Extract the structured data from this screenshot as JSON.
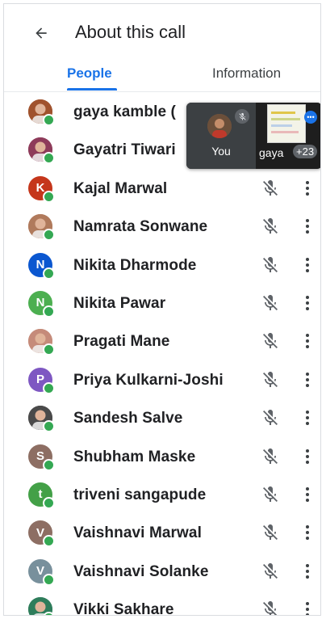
{
  "header": {
    "title": "About this call",
    "back_icon": "arrow-back-icon"
  },
  "tabs": [
    {
      "label": "People",
      "selected": true
    },
    {
      "label": "Information",
      "selected": false
    }
  ],
  "colors": {
    "accent": "#1a73e8",
    "online": "#34a853"
  },
  "participants": [
    {
      "name": "gaya kamble (",
      "avatar": "photo",
      "color": "#a0522d"
    },
    {
      "name": "Gayatri Tiwari",
      "avatar": "photo",
      "color": "#8e3b5a"
    },
    {
      "name": "Kajal Marwal",
      "avatar": "K",
      "color": "#c5361b"
    },
    {
      "name": "Namrata Sonwane",
      "avatar": "photo",
      "color": "#b07a5c"
    },
    {
      "name": "Nikita Dharmode",
      "avatar": "N",
      "color": "#0b57d0"
    },
    {
      "name": "Nikita Pawar",
      "avatar": "N",
      "color": "#4caf50"
    },
    {
      "name": "Pragati Mane",
      "avatar": "photo",
      "color": "#c58b7a"
    },
    {
      "name": "Priya Kulkarni-Joshi",
      "avatar": "P",
      "color": "#7e57c2"
    },
    {
      "name": "Sandesh Salve",
      "avatar": "photo",
      "color": "#4a4a4a"
    },
    {
      "name": "Shubham Maske",
      "avatar": "S",
      "color": "#8d6e63"
    },
    {
      "name": "triveni sangapude",
      "avatar": "t",
      "color": "#43a047"
    },
    {
      "name": "Vaishnavi Marwal",
      "avatar": "V",
      "color": "#8d6e63"
    },
    {
      "name": "Vaishnavi Solanke",
      "avatar": "V",
      "color": "#78909c"
    },
    {
      "name": "Vikki Sakhare",
      "avatar": "photo",
      "color": "#2e7d5b"
    }
  ],
  "self_view": {
    "label": "You",
    "other_label": "gaya",
    "others_count": "+23"
  }
}
